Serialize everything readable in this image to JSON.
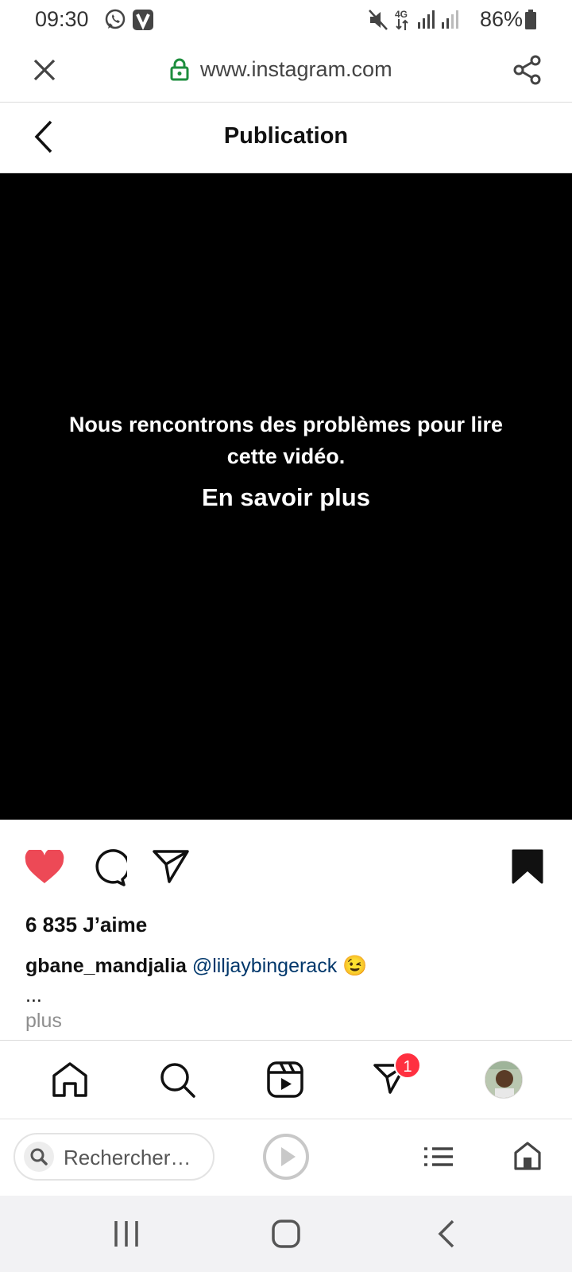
{
  "status_bar": {
    "time": "09:30",
    "network": "4G",
    "battery": "86%",
    "icons": [
      "whatsapp-icon",
      "vpn-v-icon",
      "mute-icon",
      "signal-icon",
      "battery-icon"
    ]
  },
  "browser": {
    "url": "www.instagram.com",
    "search_placeholder": "Rechercher…"
  },
  "header": {
    "title": "Publication"
  },
  "video": {
    "error_message": "Nous rencontrons des problèmes pour lire cette vidéo.",
    "learn_more": "En savoir plus"
  },
  "post": {
    "likes": "6 835 J’aime",
    "username": "gbane_mandjalia",
    "mention": "@liljaybingerack",
    "emoji": "😉",
    "ellipsis": "...",
    "more_label": "plus",
    "liked": true
  },
  "ig_nav": {
    "items": [
      "home",
      "search",
      "reels",
      "direct",
      "profile"
    ],
    "direct_badge": "1"
  },
  "colors": {
    "like_red": "#ed4956",
    "badge_red": "#ff3040",
    "lock_green": "#1e8e3e",
    "mention_blue": "#00376b"
  }
}
